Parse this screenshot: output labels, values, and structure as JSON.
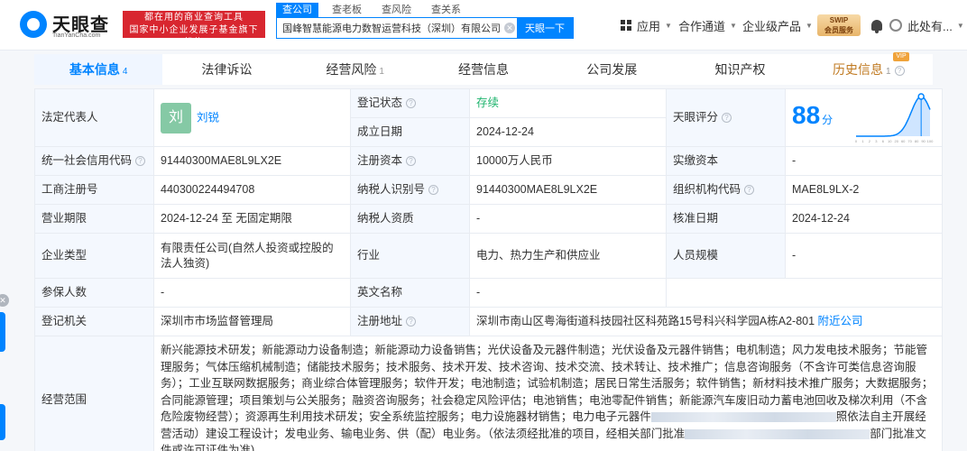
{
  "header": {
    "logo_text": "天眼查",
    "logo_sub": "TianYanCha.com",
    "promo_line1": "都在用的商业查询工具",
    "promo_line2": "国家中小企业发展子基金旗下机构",
    "search_tabs": [
      "查公司",
      "查老板",
      "查风险",
      "查关系"
    ],
    "search_value": "国峰智慧能源电力数智运营科技（深圳）有限公司",
    "search_button": "天眼一下",
    "nav": {
      "apps": "应用",
      "channel": "合作通道",
      "enterprise": "企业级产品",
      "svip_line1": "SWIP",
      "svip_line2": "会员服务",
      "user": "此处有..."
    }
  },
  "tabs": [
    {
      "label": "基本信息",
      "count": "4"
    },
    {
      "label": "法律诉讼",
      "count": ""
    },
    {
      "label": "经营风险",
      "count": "1"
    },
    {
      "label": "经营信息",
      "count": ""
    },
    {
      "label": "公司发展",
      "count": ""
    },
    {
      "label": "知识产权",
      "count": ""
    },
    {
      "label": "历史信息",
      "count": "1"
    }
  ],
  "vip_tag": "VIP",
  "info": {
    "legal_rep_label": "法定代表人",
    "legal_rep_avatar": "刘",
    "legal_rep": "刘锐",
    "reg_status_label": "登记状态",
    "reg_status": "存续",
    "est_date_label": "成立日期",
    "est_date": "2024-12-24",
    "score_label": "天眼评分",
    "score": "88",
    "score_unit": "分",
    "credit_code_label": "统一社会信用代码",
    "credit_code": "91440300MAE8L9LX2E",
    "reg_capital_label": "注册资本",
    "reg_capital": "10000万人民币",
    "paid_capital_label": "实缴资本",
    "paid_capital": "-",
    "biz_reg_no_label": "工商注册号",
    "biz_reg_no": "440300224494708",
    "taxpayer_id_label": "纳税人识别号",
    "taxpayer_id": "91440300MAE8L9LX2E",
    "org_code_label": "组织机构代码",
    "org_code": "MAE8L9LX-2",
    "term_label": "营业期限",
    "term": "2024-12-24 至 无固定期限",
    "taxpayer_qual_label": "纳税人资质",
    "taxpayer_qual": "-",
    "approve_date_label": "核准日期",
    "approve_date": "2024-12-24",
    "company_type_label": "企业类型",
    "company_type": "有限责任公司(自然人投资或控股的法人独资)",
    "industry_label": "行业",
    "industry": "电力、热力生产和供应业",
    "staff_size_label": "人员规模",
    "staff_size": "-",
    "insured_label": "参保人数",
    "insured": "-",
    "en_name_label": "英文名称",
    "en_name": "-",
    "authority_label": "登记机关",
    "authority": "深圳市市场监督管理局",
    "address_label": "注册地址",
    "address": "深圳市南山区粤海街道科技园社区科苑路15号科兴科学园A栋A2-801",
    "nearby_link": "附近公司",
    "scope_label": "经营范围",
    "scope_part1": "新兴能源技术研发；新能源动力设备制造；新能源动力设备销售；光伏设备及元器件制造；光伏设备及元器件销售；电机制造；风力发电技术服务；节能管理服务；气体压缩机械制造；储能技术服务；技术服务、技术开发、技术咨询、技术交流、技术转让、技术推广；信息咨询服务（不含许可类信息咨询服务）；工业互联网数据服务；商业综合体管理服务；软件开发；电池制造；试验机制造；居民日常生活服务；软件销售；新材料技术推广服务；大数据服务；合同能源管理；项目策划与公关服务；融资咨询服务；社会稳定风险评估；电池销售；电池零配件销售；新能源汽车废旧动力蓄电池回收及梯次利用（不含危险废物经营）；资源再生利用技术研发；安全系统监控服务；电力设施器材销售；电力电子元器件",
    "scope_part2": "照依法自主开展经营活动）建设工程设计；发电业务、输电业务、供（配）电业务。（依法须经批准的项目，经相关部门批准",
    "scope_part3": "部门批准文件或许可证件为准)"
  },
  "score_chart": {
    "type": "area",
    "x_ticks": [
      "0",
      "1",
      "2",
      "3",
      "6",
      "10",
      "20",
      "60",
      "70",
      "80",
      "90",
      "100"
    ],
    "score": 88
  }
}
